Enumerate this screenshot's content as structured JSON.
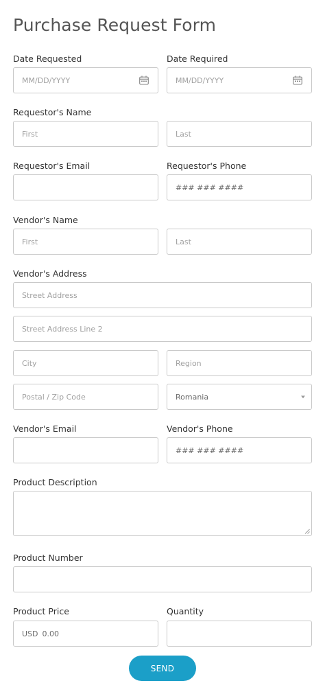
{
  "form": {
    "title": "Purchase Request Form",
    "date_requested": {
      "label": "Date Requested",
      "placeholder": "MM/DD/YYYY"
    },
    "date_required": {
      "label": "Date Required",
      "placeholder": "MM/DD/YYYY"
    },
    "requestor_name": {
      "label": "Requestor's Name",
      "first": "First",
      "last": "Last"
    },
    "requestor_email": {
      "label": "Requestor's Email",
      "value": ""
    },
    "requestor_phone": {
      "label": "Requestor's Phone",
      "placeholder": "### ### ####"
    },
    "vendor_name": {
      "label": "Vendor's Name",
      "first": "First",
      "last": "Last"
    },
    "vendor_address": {
      "label": "Vendor's Address",
      "street": "Street Address",
      "street2": "Street Address Line 2",
      "city": "City",
      "region": "Region",
      "postal": "Postal / Zip Code",
      "country": "Romania"
    },
    "vendor_email": {
      "label": "Vendor's Email",
      "value": ""
    },
    "vendor_phone": {
      "label": "Vendor's Phone",
      "placeholder": "### ### ####"
    },
    "product_description": {
      "label": "Product Description",
      "value": ""
    },
    "product_number": {
      "label": "Product Number",
      "value": ""
    },
    "product_price": {
      "label": "Product Price",
      "currency": "USD",
      "placeholder": "0.00"
    },
    "quantity": {
      "label": "Quantity",
      "value": ""
    },
    "send_label": "SEND"
  }
}
